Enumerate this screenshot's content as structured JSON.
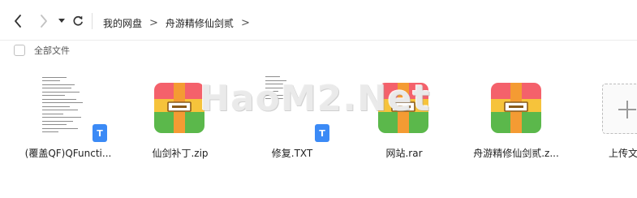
{
  "breadcrumb": {
    "items": [
      "我的网盘",
      "舟游精修仙剑贰"
    ],
    "separator": ">"
  },
  "toolbar": {
    "select_all_label": "全部文件"
  },
  "files": [
    {
      "name": "(覆盖QF)QFuncti...",
      "type": "text-doc",
      "badge": "T"
    },
    {
      "name": "仙剑补丁.zip",
      "type": "archive"
    },
    {
      "name": "修复.TXT",
      "type": "text-doc",
      "badge": "T"
    },
    {
      "name": "网站.rar",
      "type": "archive"
    },
    {
      "name": "舟游精修仙剑贰.z...",
      "type": "archive"
    }
  ],
  "upload": {
    "label": "上传文件"
  },
  "watermark": {
    "text": "HaoM2.Net"
  },
  "colors": {
    "badge": "#3b8af6",
    "archive_top": "#f4616b",
    "archive_bottom": "#5bb84b",
    "archive_accent": "#f49b33"
  }
}
